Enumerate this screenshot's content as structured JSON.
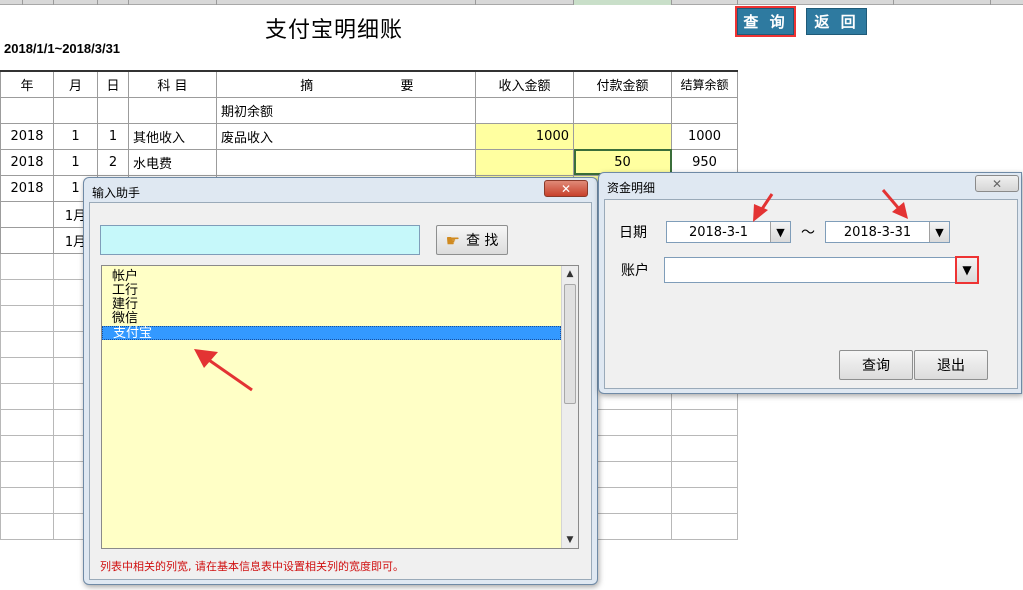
{
  "sheet": {
    "title": "支付宝明细账",
    "date_range": "2018/1/1~2018/3/31",
    "buttons": {
      "query": "查 询",
      "back": "返 回"
    },
    "headers": [
      "年",
      "月",
      "日",
      "科 目",
      "摘",
      "要",
      "收入金额",
      "付款金额",
      "结算余额"
    ],
    "rows": [
      {
        "year": "",
        "month": "",
        "day": "",
        "subject": "",
        "summary": "期初余额",
        "income": "",
        "payment": "",
        "balance": ""
      },
      {
        "year": "2018",
        "month": "1",
        "day": "1",
        "subject": "其他收入",
        "summary": "废品收入",
        "income": "1000",
        "payment": "",
        "balance": "1000"
      },
      {
        "year": "2018",
        "month": "1",
        "day": "2",
        "subject": "水电费",
        "summary": "",
        "income": "",
        "payment": "50",
        "balance": "950"
      },
      {
        "year": "2018",
        "month": "1",
        "day": "",
        "subject": "",
        "summary": "",
        "income": "",
        "payment": "",
        "balance": ""
      },
      {
        "year": "",
        "month": "1月",
        "day": "",
        "subject": "",
        "summary": "",
        "income": "",
        "payment": "",
        "balance": ""
      },
      {
        "year": "",
        "month": "1月",
        "day": "",
        "subject": "",
        "summary": "",
        "income": "",
        "payment": "",
        "balance": ""
      }
    ]
  },
  "input_helper": {
    "title": "输入助手",
    "close_symbol": "✕",
    "search_value": "",
    "find_label": "查 找",
    "items": [
      "帐户",
      "工行",
      "建行",
      "微信",
      "支付宝"
    ],
    "selected_index": 4,
    "note": "列表中相关的列宽, 请在基本信息表中设置相关列的宽度即可。"
  },
  "fund_detail": {
    "title": "资金明细",
    "close_symbol": "✕",
    "date_label": "日期",
    "date_from": "2018-3-1",
    "tilde": "～",
    "date_to": "2018-3-31",
    "account_label": "账户",
    "account_value": "",
    "query_label": "查询",
    "exit_label": "退出"
  },
  "colors": {
    "accent_blue": "#2e7aa0",
    "highlight_yellow": "#ffffa0",
    "list_yellow": "#ffffc6",
    "search_cyan": "#c6f8fa",
    "close_red": "#c8412b",
    "annotation_red": "#e33333",
    "selection_blue": "#3399ff"
  }
}
